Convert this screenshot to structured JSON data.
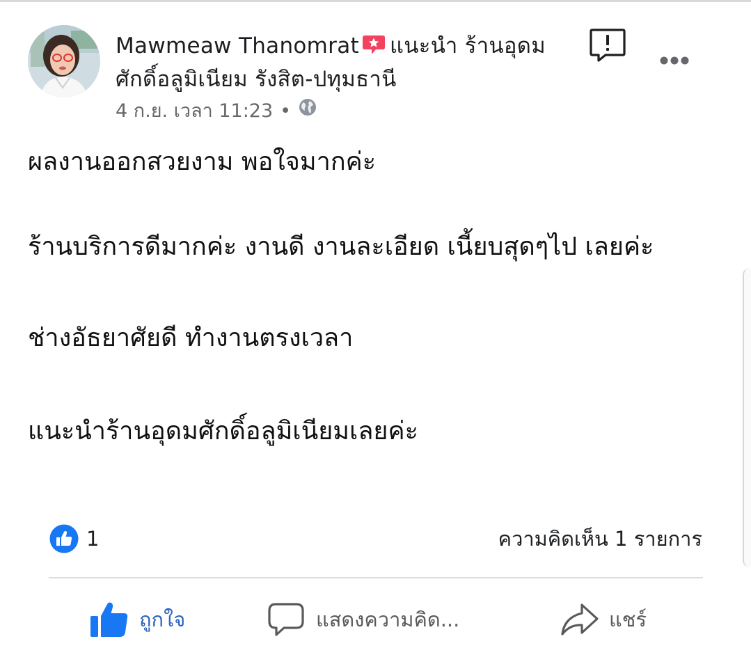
{
  "post": {
    "author_name": "Mawmeaw Thanomrat",
    "recommend_text": "แนะนำ ร้านอุดมศักดิ์อลูมิเนียม รังสิต-ปทุมธานี",
    "date": "4 ก.ย. เวลา 11:23",
    "separator": "•",
    "privacy_icon": "globe-icon",
    "paragraphs": [
      "ผลงานออกสวยงาม พอใจมากค่ะ",
      "ร้านบริการดีมากค่ะ งานดี งานละเอียด เนี้ยบสุดๆไป เลยค่ะ",
      "ช่างอัธยาศัยดี ทำงานตรงเวลา",
      "แนะนำร้านอุดมศักดิ์อลูมิเนียมเลยค่ะ"
    ]
  },
  "stats": {
    "like_count": "1",
    "comment_count": "ความคิดเห็น 1 รายการ"
  },
  "actions": {
    "like_label": "ถูกใจ",
    "comment_label": "แสดงความคิด...",
    "share_label": "แชร์"
  },
  "colors": {
    "brand_blue": "#1877f2",
    "recommend_red": "#f3425f",
    "meta_gray": "#65676b"
  }
}
